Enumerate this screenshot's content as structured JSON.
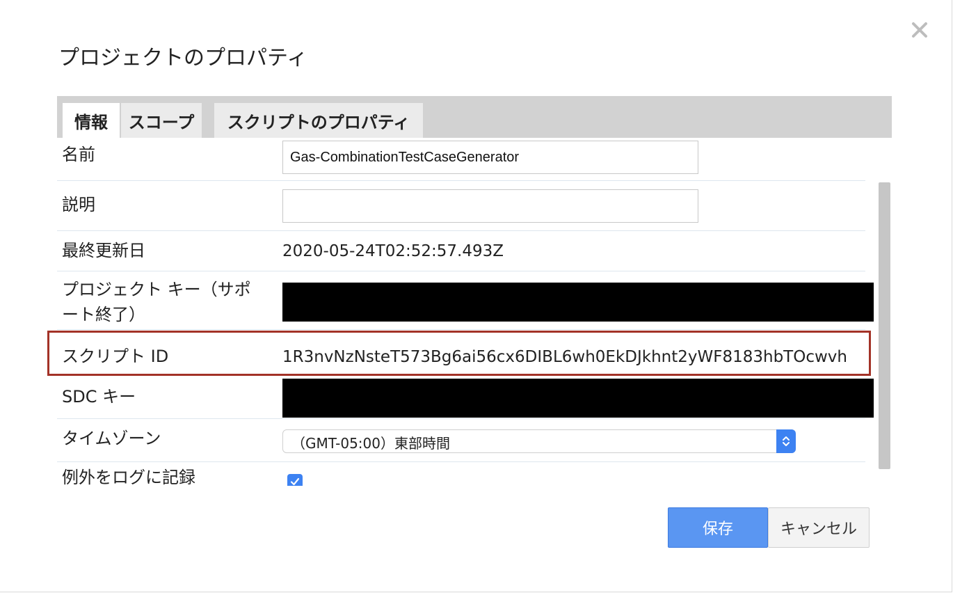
{
  "dialog": {
    "title": "プロジェクトのプロパティ",
    "close_icon": "close-icon"
  },
  "tabs": [
    {
      "label": "情報",
      "active": true
    },
    {
      "label": "スコープ",
      "active": false
    },
    {
      "label": "スクリプトのプロパティ",
      "active": false
    }
  ],
  "fields": {
    "name": {
      "label": "名前",
      "value": "Gas-CombinationTestCaseGenerator"
    },
    "description": {
      "label": "説明",
      "value": ""
    },
    "last_modified": {
      "label": "最終更新日",
      "value": "2020-05-24T02:52:57.493Z"
    },
    "project_key": {
      "label_line1": "プロジェクト キー（サポ",
      "label_line2": "ート終了）"
    },
    "script_id": {
      "label": "スクリプト ID",
      "value": "1R3nvNzNsteT573Bg6ai56cx6DIBL6wh0EkDJkhnt2yWF8183hbTOcwvh"
    },
    "sdc_key": {
      "label": "SDC キー"
    },
    "timezone": {
      "label": "タイムゾーン",
      "value": "（GMT-05:00）東部時間"
    },
    "log_exceptions": {
      "label": "例外をログに記録",
      "checked": true
    }
  },
  "buttons": {
    "save": "保存",
    "cancel": "キャンセル"
  },
  "colors": {
    "primary": "#5a96f2",
    "highlight_border": "#a33227",
    "tabbar": "#d2d2d2",
    "redaction": "#000000"
  }
}
